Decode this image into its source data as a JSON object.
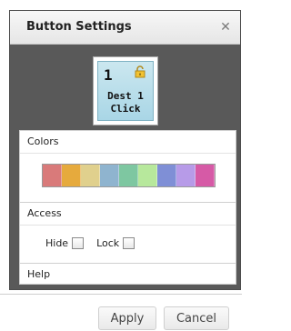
{
  "dialog": {
    "title": "Button Settings",
    "close_icon": "close-icon",
    "preview": {
      "number": "1",
      "label": "Dest 1 Click",
      "locked_icon": "lock-icon",
      "colors": {
        "fill": "#bfe2ec",
        "border": "#7fb2c3"
      }
    }
  },
  "colors_panel": {
    "title": "Colors",
    "swatches": [
      "#d97a7a",
      "#e6aa3d",
      "#e0d08d",
      "#8fb4cf",
      "#7ec7a1",
      "#b7e89c",
      "#7f8fd6",
      "#b79be8",
      "#d65aa6"
    ]
  },
  "access_panel": {
    "title": "Access",
    "hide_label": "Hide",
    "lock_label": "Lock"
  },
  "help_panel": {
    "title": "Help"
  },
  "actions": {
    "apply": "Apply",
    "cancel": "Cancel"
  }
}
